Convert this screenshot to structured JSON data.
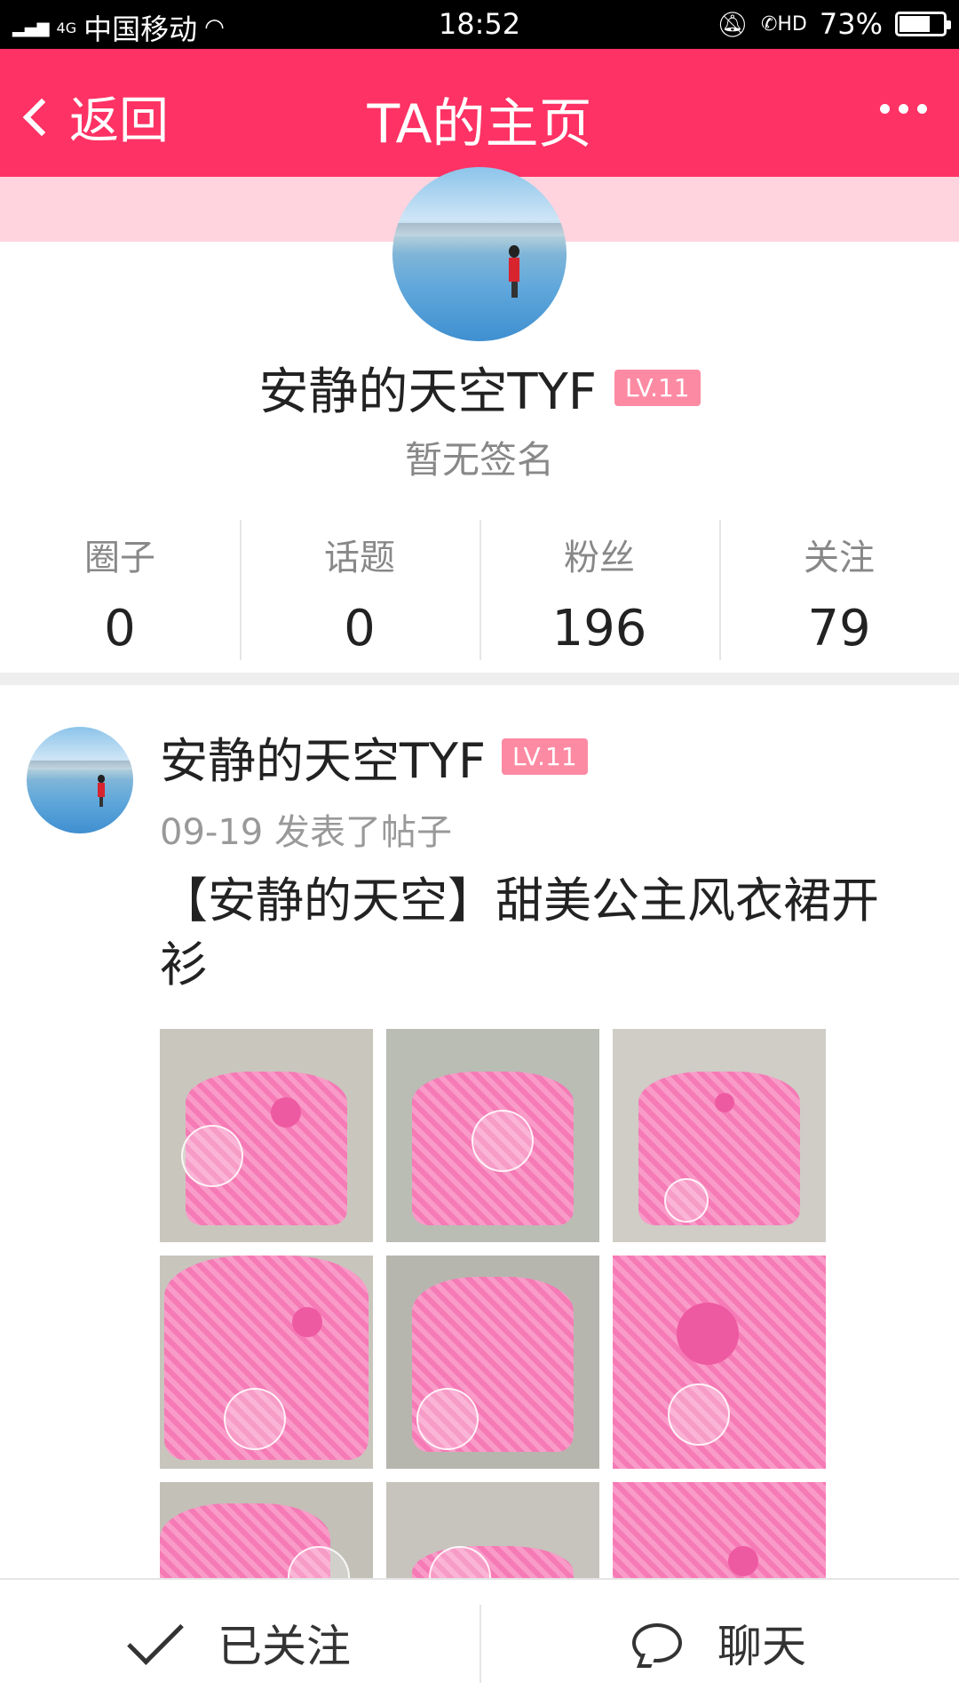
{
  "status_bar": {
    "network": "4G",
    "carrier": "中国移动",
    "time": "18:52",
    "hd": "HD",
    "battery_text": "73%",
    "battery_level": 0.73
  },
  "nav": {
    "back_label": "返回",
    "title": "TA的主页"
  },
  "profile": {
    "name": "安静的天空TYF",
    "level": "LV.11",
    "signature": "暂无签名"
  },
  "stats": [
    {
      "label": "圈子",
      "value": "0"
    },
    {
      "label": "话题",
      "value": "0"
    },
    {
      "label": "粉丝",
      "value": "196"
    },
    {
      "label": "关注",
      "value": "79"
    }
  ],
  "post": {
    "author": "安静的天空TYF",
    "level": "LV.11",
    "meta": "09-19 发表了帖子",
    "title": "【安静的天空】甜美公主风衣裙开衫"
  },
  "bottom_bar": {
    "follow_label": "已关注",
    "chat_label": "聊天"
  },
  "colors": {
    "accent": "#fe3264",
    "badge": "#fd8aa3",
    "band": "#ffd4de"
  }
}
